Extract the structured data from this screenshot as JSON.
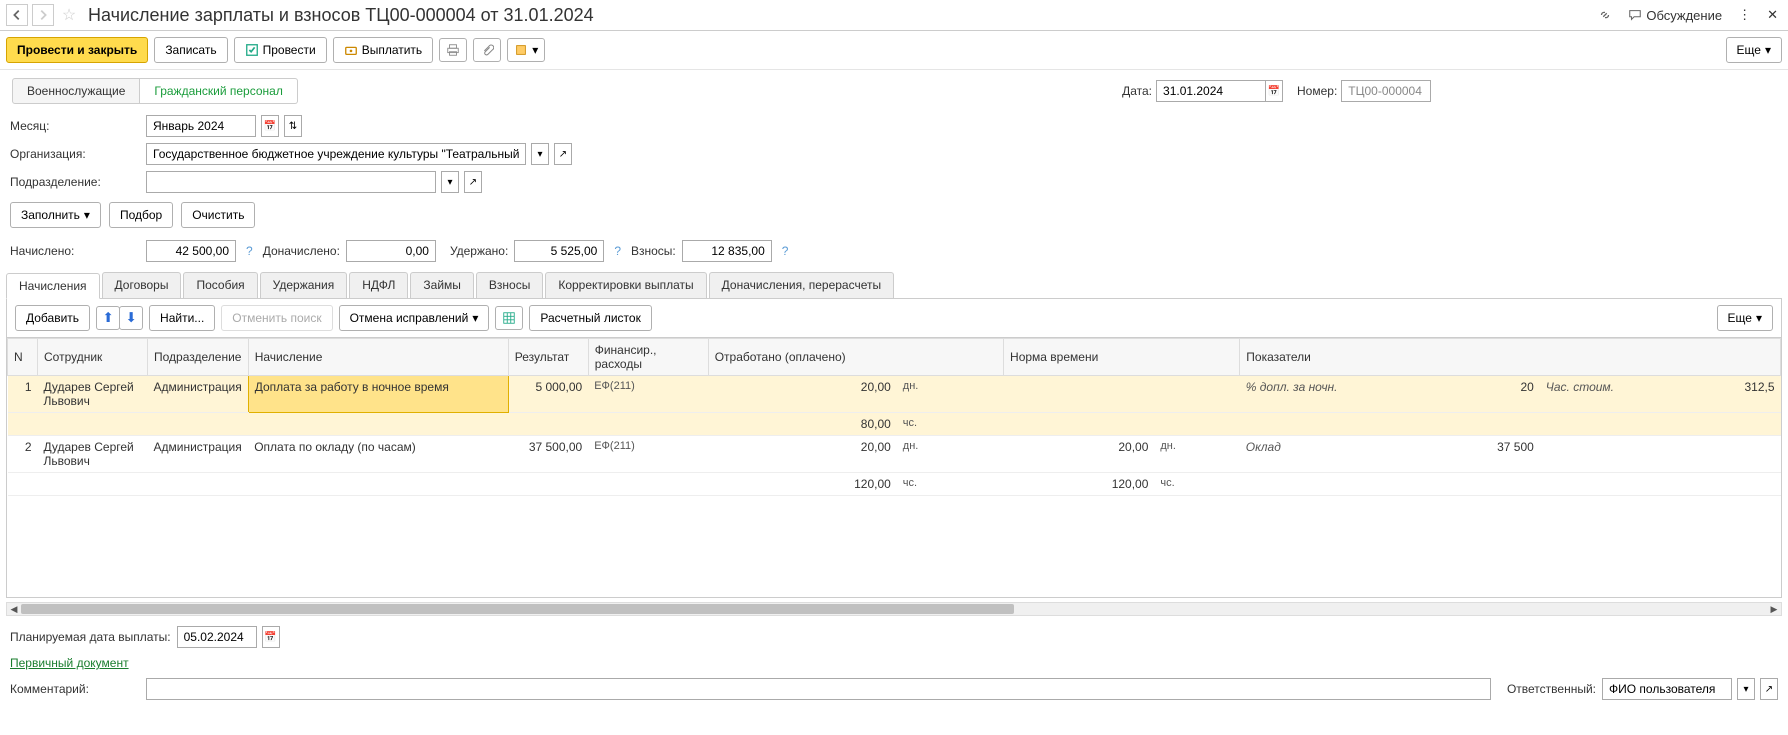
{
  "titlebar": {
    "title": "Начисление зарплаты и взносов ТЦ00-000004 от 31.01.2024",
    "discuss": "Обсуждение"
  },
  "toolbar": {
    "post_close": "Провести и закрыть",
    "save": "Записать",
    "post": "Провести",
    "pay": "Выплатить",
    "more": "Еще"
  },
  "category_tabs": {
    "military": "Военнослужащие",
    "civil": "Гражданский персонал"
  },
  "header": {
    "date_label": "Дата:",
    "date_value": "31.01.2024",
    "number_label": "Номер:",
    "number_value": "ТЦ00-000004"
  },
  "fields": {
    "month_label": "Месяц:",
    "month_value": "Январь 2024",
    "org_label": "Организация:",
    "org_value": "Государственное бюджетное учреждение культуры \"Театральный центр\"",
    "dept_label": "Подразделение:",
    "dept_value": ""
  },
  "actions": {
    "fill": "Заполнить",
    "select": "Подбор",
    "clear": "Очистить"
  },
  "totals": {
    "accrued_label": "Начислено:",
    "accrued": "42 500,00",
    "extra_label": "Доначислено:",
    "extra": "0,00",
    "withheld_label": "Удержано:",
    "withheld": "5 525,00",
    "contrib_label": "Взносы:",
    "contrib": "12 835,00"
  },
  "tabs": [
    "Начисления",
    "Договоры",
    "Пособия",
    "Удержания",
    "НДФЛ",
    "Займы",
    "Взносы",
    "Корректировки выплаты",
    "Доначисления, перерасчеты"
  ],
  "subtoolbar": {
    "add": "Добавить",
    "find": "Найти...",
    "cancel_find": "Отменить поиск",
    "cancel_fix": "Отмена исправлений",
    "payslip": "Расчетный листок",
    "more": "Еще"
  },
  "grid": {
    "headers": {
      "n": "N",
      "employee": "Сотрудник",
      "dept": "Подразделение",
      "accrual": "Начисление",
      "result": "Результат",
      "fin": "Финансир., расходы",
      "worked": "Отработано (оплачено)",
      "norm": "Норма времени",
      "indicators": "Показатели"
    },
    "rows": [
      {
        "n": "1",
        "employee": "Дударев Сергей Львович",
        "dept": "Администрация",
        "accrual": "Доплата за работу в ночное время",
        "result": "5 000,00",
        "fin": "ЕФ(211)",
        "worked_days": "20,00",
        "worked_days_unit": "дн.",
        "worked_hours": "80,00",
        "worked_hours_unit": "чс.",
        "norm_days": "",
        "norm_hours": "",
        "ind1_name": "% допл. за ночн.",
        "ind1_val": "20",
        "ind2_name": "Час. стоим.",
        "ind2_val": "312,5",
        "selected": true
      },
      {
        "n": "2",
        "employee": "Дударев Сергей Львович",
        "dept": "Администрация",
        "accrual": "Оплата по окладу (по часам)",
        "result": "37 500,00",
        "fin": "ЕФ(211)",
        "worked_days": "20,00",
        "worked_days_unit": "дн.",
        "worked_hours": "120,00",
        "worked_hours_unit": "чс.",
        "norm_days": "20,00",
        "norm_days_unit": "дн.",
        "norm_hours": "120,00",
        "norm_hours_unit": "чс.",
        "ind1_name": "Оклад",
        "ind1_val": "37 500",
        "ind2_name": "",
        "ind2_val": "",
        "selected": false
      }
    ]
  },
  "footer": {
    "plan_date_label": "Планируемая дата выплаты:",
    "plan_date": "05.02.2024",
    "primary_doc": "Первичный документ",
    "comment_label": "Комментарий:",
    "responsible_label": "Ответственный:",
    "responsible": "ФИО пользователя"
  }
}
